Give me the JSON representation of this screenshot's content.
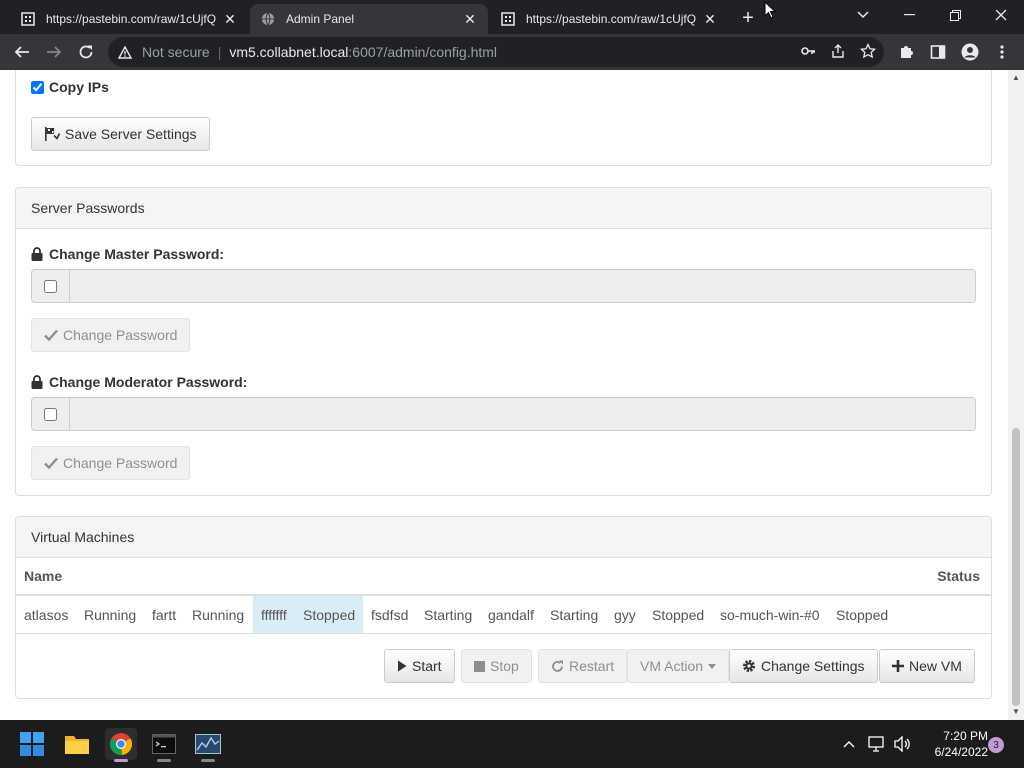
{
  "browser": {
    "tabs": [
      {
        "title": "https://pastebin.com/raw/1cUjfQ",
        "active": false
      },
      {
        "title": "Admin Panel",
        "active": true
      },
      {
        "title": "https://pastebin.com/raw/1cUjfQ",
        "active": false
      }
    ],
    "address": {
      "security_label": "Not secure",
      "host": "vm5.collabnet.local",
      "path": ":6007/admin/config.html"
    }
  },
  "server_settings": {
    "copy_ips_label": "Copy IPs",
    "copy_ips_checked": true,
    "save_button": "Save Server Settings"
  },
  "passwords": {
    "heading": "Server Passwords",
    "master_label": "Change Master Password:",
    "moderator_label": "Change Moderator Password:",
    "change_button": "Change Password"
  },
  "vms": {
    "heading": "Virtual Machines",
    "columns": {
      "name": "Name",
      "status": "Status"
    },
    "row": [
      {
        "text": "atlasos",
        "selected": false
      },
      {
        "text": "Running",
        "selected": false
      },
      {
        "text": "fartt",
        "selected": false
      },
      {
        "text": "Running",
        "selected": false
      },
      {
        "text": "fffffff",
        "selected": true
      },
      {
        "text": "Stopped",
        "selected": true
      },
      {
        "text": "fsdfsd",
        "selected": false
      },
      {
        "text": "Starting",
        "selected": false
      },
      {
        "text": "gandalf",
        "selected": false
      },
      {
        "text": "Starting",
        "selected": false
      },
      {
        "text": "gyy",
        "selected": false
      },
      {
        "text": "Stopped",
        "selected": false
      },
      {
        "text": "so-much-win-#0",
        "selected": false
      },
      {
        "text": "Stopped",
        "selected": false
      }
    ],
    "buttons": {
      "start": "Start",
      "stop": "Stop",
      "restart": "Restart",
      "vm_action": "VM Action",
      "change_settings": "Change Settings",
      "new_vm": "New VM"
    }
  },
  "taskbar": {
    "time": "7:20 PM",
    "date": "6/24/2022",
    "notification_count": "3"
  }
}
